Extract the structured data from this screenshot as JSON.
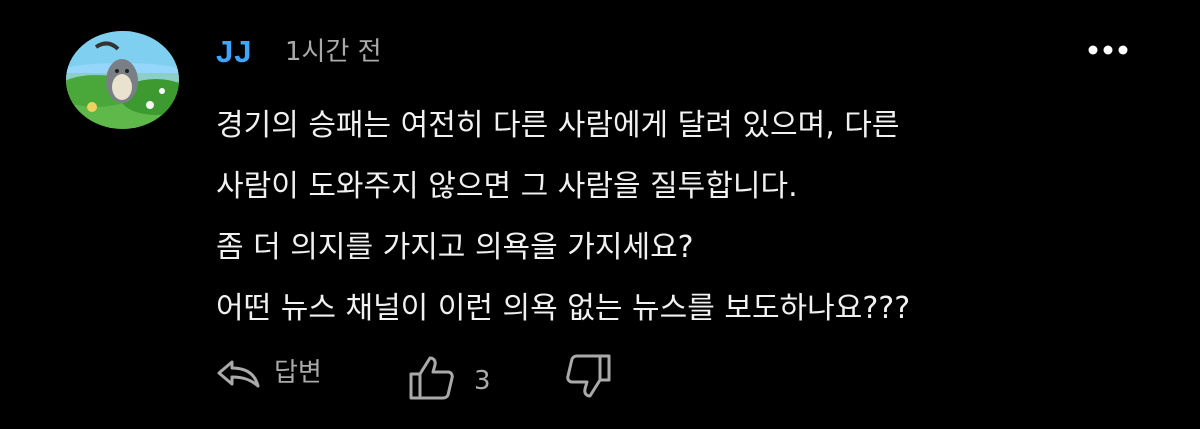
{
  "comment": {
    "author": "JJ",
    "time": "1시간 전",
    "avatar": {
      "description_icon": "avatar-image"
    },
    "body_lines": [
      "경기의 승패는 여전히 다른 사람에게 달려 있으며, 다른",
      "사람이 도와주지 않으면 그 사람을 질투합니다.",
      "좀 더 의지를 가지고 의욕을 가지세요?",
      "어떤 뉴스 채널이 이런 의욕 없는 뉴스를 보도하나요???"
    ],
    "actions": {
      "reply_label": "답변",
      "like_count": "3",
      "more_icon": "more-options-icon",
      "reply_icon": "reply-arrow-icon",
      "like_icon": "thumbs-up-icon",
      "dislike_icon": "thumbs-down-icon"
    }
  },
  "colors": {
    "background": "#000000",
    "author": "#3ea6ff",
    "text": "#f1f1f1",
    "secondary": "#aaaaaa"
  }
}
